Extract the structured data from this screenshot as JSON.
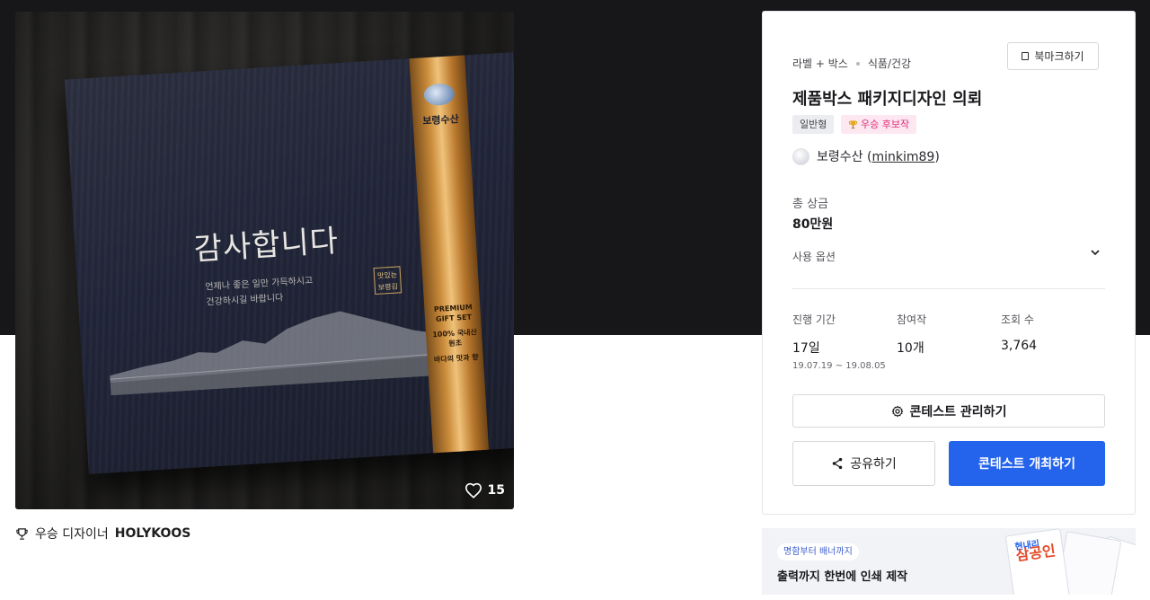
{
  "product": {
    "box_title": "감사합니다",
    "box_subtitle_line1": "언제나 좋은 일만 가득하시고",
    "box_subtitle_line2": "건강하시길 바랍니다",
    "box_stamp": "맛있는 보령김",
    "box_brand": "보령수산",
    "box_premium": "PREMIUM GIFT SET",
    "box_origin": "100% 국내산 원초",
    "box_tagline": "바다의 맛과 향",
    "likes_count": "15"
  },
  "winner": {
    "label": "우승 디자이너",
    "name": "HOLYKOOS"
  },
  "contest": {
    "category_main": "라벨 + 박스",
    "category_sub": "식품/건강",
    "bookmark_label": "북마크하기",
    "title": "제품박스 패키지디자인 의뢰",
    "tag_type": "일반형",
    "tag_status": "우승 후보작",
    "host_name": "보령수산",
    "host_id": "minkim89",
    "prize_label": "총 상금",
    "prize_value": "80만원",
    "usage_label": "사용 옵션",
    "stats": {
      "period_label": "진행 기간",
      "period_value": "17일",
      "period_dates": "19.07.19 ~ 19.08.05",
      "entries_label": "참여작",
      "entries_value": "10개",
      "views_label": "조회 수",
      "views_value": "3,764"
    },
    "manage_button": "콘테스트 관리하기",
    "share_button": "공유하기",
    "host_button": "콘테스트 개최하기"
  },
  "ad": {
    "tag": "명함부터 배너까지",
    "text": "출력까지 한번에 인쇄 제작",
    "card_sub": "현내리",
    "card_text": "삼공인"
  },
  "colors": {
    "primary": "#2463eb",
    "hero_bg": "#17171a",
    "tag_pink": "#e02c76"
  }
}
